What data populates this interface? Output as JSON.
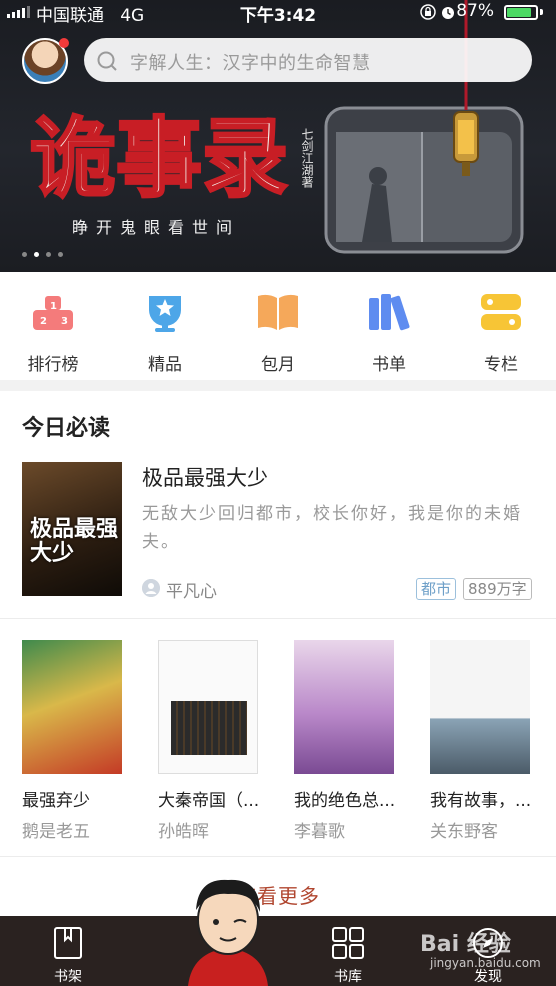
{
  "status_bar": {
    "carrier": "中国联通",
    "network": "4G",
    "time": "下午3:42",
    "battery": "87%",
    "battery_level": 0.87
  },
  "search": {
    "placeholder": "字解人生：汉字中的生命智慧"
  },
  "banner": {
    "title": "诡事录",
    "author_tag": "七剑江湖著",
    "slogan": "睁开鬼眼看世间",
    "page_dots": 4,
    "active_dot": 1
  },
  "categories": [
    {
      "label": "排行榜",
      "icon": "ranking-podium-icon",
      "color": "#f47b7b"
    },
    {
      "label": "精品",
      "icon": "trophy-icon",
      "color": "#4da6e8"
    },
    {
      "label": "包月",
      "icon": "open-book-icon",
      "color": "#f5a85a"
    },
    {
      "label": "书单",
      "icon": "books-icon",
      "color": "#5e8cf0"
    },
    {
      "label": "专栏",
      "icon": "column-toggle-icon",
      "color": "#f7c536"
    }
  ],
  "today": {
    "title": "今日必读",
    "featured": {
      "cover_text": "极品最强大少",
      "name": "极品最强大少",
      "description": "无敌大少回归都市，校长你好，我是你的未婚夫。",
      "author": "平凡心",
      "genre": "都市",
      "words": "889万字"
    },
    "books": [
      {
        "name": "最强弃少",
        "author": "鹅是老五"
      },
      {
        "name": "大秦帝国（...",
        "author": "孙皓晖"
      },
      {
        "name": "我的绝色总...",
        "author": "李暮歌"
      },
      {
        "name": "我有故事，...",
        "author": "关东野客"
      }
    ],
    "more": "查看更多"
  },
  "tabbar": [
    {
      "label": "书架",
      "icon": "bookmark-book-icon"
    },
    {
      "label": "书库",
      "icon": "grid-library-icon"
    },
    {
      "label": "发现",
      "icon": "discover-icon"
    }
  ],
  "watermark": {
    "text": "Bai 经验",
    "sub": "jingyan.baidu.com"
  }
}
